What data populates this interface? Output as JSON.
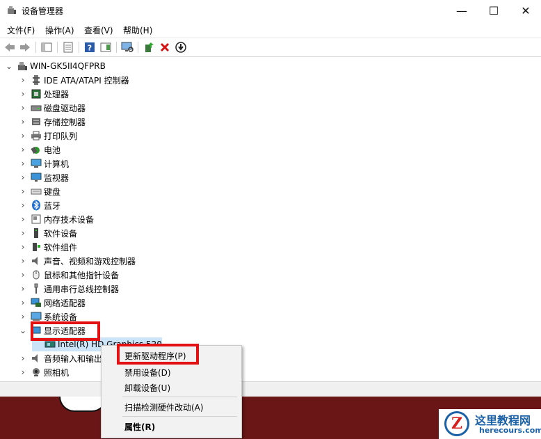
{
  "window": {
    "title": "设备管理器",
    "minimize": "—",
    "maximize": "☐",
    "close": "✕"
  },
  "menu": [
    {
      "label": "文件(F)"
    },
    {
      "label": "操作(A)"
    },
    {
      "label": "查看(V)"
    },
    {
      "label": "帮助(H)"
    }
  ],
  "tree": {
    "root": "WIN-GK5II4QFPRB",
    "items": [
      {
        "label": "IDE ATA/ATAPI 控制器",
        "icon": "ide-controller-icon"
      },
      {
        "label": "处理器",
        "icon": "processor-icon"
      },
      {
        "label": "磁盘驱动器",
        "icon": "disk-drive-icon"
      },
      {
        "label": "存储控制器",
        "icon": "storage-controller-icon"
      },
      {
        "label": "打印队列",
        "icon": "printer-icon"
      },
      {
        "label": "电池",
        "icon": "battery-icon"
      },
      {
        "label": "计算机",
        "icon": "computer-icon"
      },
      {
        "label": "监视器",
        "icon": "monitor-icon"
      },
      {
        "label": "键盘",
        "icon": "keyboard-icon"
      },
      {
        "label": "蓝牙",
        "icon": "bluetooth-icon"
      },
      {
        "label": "内存技术设备",
        "icon": "memory-device-icon"
      },
      {
        "label": "软件设备",
        "icon": "software-device-icon"
      },
      {
        "label": "软件组件",
        "icon": "software-component-icon"
      },
      {
        "label": "声音、视频和游戏控制器",
        "icon": "sound-icon"
      },
      {
        "label": "鼠标和其他指针设备",
        "icon": "mouse-icon"
      },
      {
        "label": "通用串行总线控制器",
        "icon": "usb-icon"
      },
      {
        "label": "网络适配器",
        "icon": "network-adapter-icon"
      },
      {
        "label": "系统设备",
        "icon": "system-device-icon"
      },
      {
        "label": "显示适配器",
        "icon": "display-adapter-icon"
      },
      {
        "label": "Intel(R) HD Graphics 520",
        "icon": "graphics-card-icon"
      },
      {
        "label": "音频输入和输出",
        "icon": "audio-io-icon"
      },
      {
        "label": "照相机",
        "icon": "camera-icon"
      }
    ]
  },
  "context_menu": {
    "update_driver": "更新驱动程序(P)",
    "disable_device": "禁用设备(D)",
    "uninstall_device": "卸载设备(U)",
    "scan_hardware": "扫描检测硬件改动(A)",
    "properties": "属性(R)"
  },
  "watermark": {
    "letter": "Z",
    "name": "这里教程网",
    "url": "herecours.com"
  },
  "colors": {
    "highlight": "#e31111",
    "bottom_band": "#6b1616",
    "logo_blue": "#1a61a8"
  }
}
